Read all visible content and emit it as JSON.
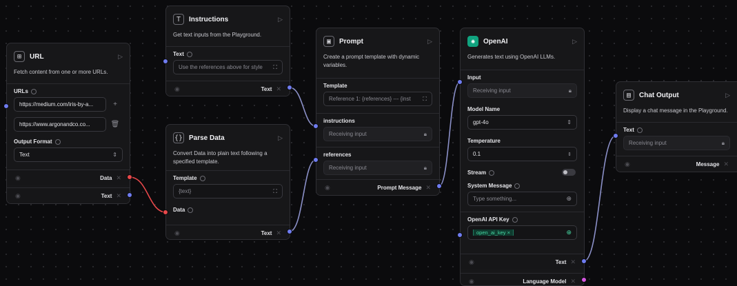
{
  "url_node": {
    "title": "URL",
    "description": "Fetch content from one or more URLs.",
    "urls_label": "URLs",
    "urls": [
      "https://medium.com/iris-by-a...",
      "https://www.argonandco.co..."
    ],
    "format_label": "Output Format",
    "format_value": "Text",
    "outputs": [
      "Data",
      "Text"
    ]
  },
  "instructions_node": {
    "title": "Instructions",
    "description": "Get text inputs from the Playground.",
    "text_label": "Text",
    "text_placeholder": "Use the references above for style",
    "output": "Text"
  },
  "parse_node": {
    "title": "Parse Data",
    "description": "Convert Data into plain text following a specified template.",
    "template_label": "Template",
    "template_value": "{text}",
    "data_label": "Data",
    "output": "Text"
  },
  "prompt_node": {
    "title": "Prompt",
    "description": "Create a prompt template with dynamic variables.",
    "template_label": "Template",
    "template_value": "Reference 1: {references} --- {inst",
    "instructions_label": "instructions",
    "instructions_value": "Receiving input",
    "references_label": "references",
    "references_value": "Receiving input",
    "output": "Prompt Message"
  },
  "openai_node": {
    "title": "OpenAI",
    "description": "Generates text using OpenAI LLMs.",
    "input_label": "Input",
    "input_value": "Receiving input",
    "model_label": "Model Name",
    "model_value": "gpt-4o",
    "temp_label": "Temperature",
    "temp_value": "0.1",
    "stream_label": "Stream",
    "system_label": "System Message",
    "system_placeholder": "Type something...",
    "apikey_label": "OpenAI API Key",
    "apikey_value": "open_ai_key",
    "outputs": [
      "Text",
      "Language Model"
    ]
  },
  "chat_node": {
    "title": "Chat Output",
    "description": "Display a chat message in the Playground.",
    "text_label": "Text",
    "text_value": "Receiving input",
    "output": "Message"
  },
  "colors": {
    "handle_blue": "#6f7cf0",
    "handle_red": "#e8484a",
    "handle_pink": "#d556e0",
    "openai_green": "#10a37f"
  }
}
